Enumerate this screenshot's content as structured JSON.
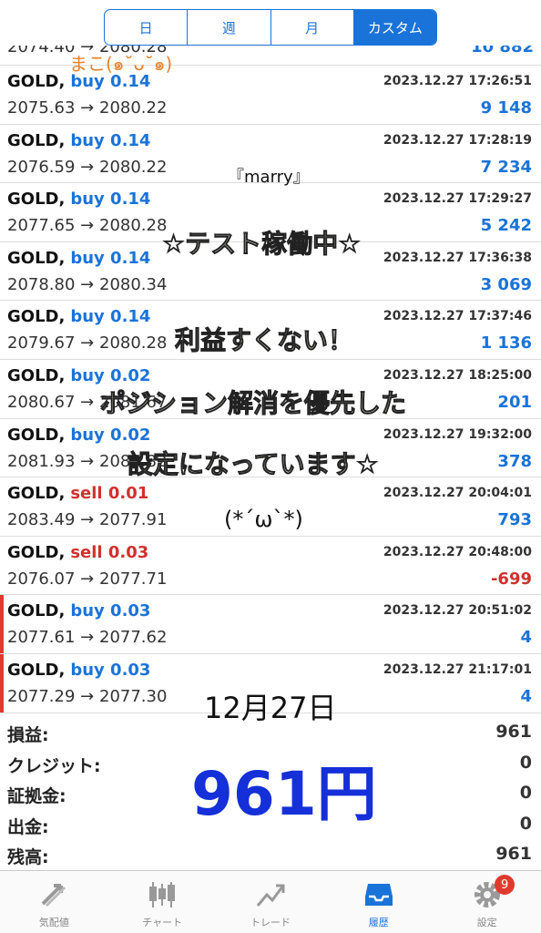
{
  "segments": [
    "日",
    "週",
    "月",
    "カスタム"
  ],
  "active_segment": "カスタム",
  "partial_row": {
    "left": "2074.40 → 2080.28",
    "right": "10 882"
  },
  "trades": [
    {
      "symbol": "GOLD,",
      "side": "buy",
      "volume": "0.14",
      "time": "2023.12.27 17:26:51",
      "open": "2075.63",
      "close": "2080.22",
      "arrow": "→",
      "profit": "9 148",
      "marked": false
    },
    {
      "symbol": "GOLD,",
      "side": "buy",
      "volume": "0.14",
      "time": "2023.12.27 17:28:19",
      "open": "2076.59",
      "close": "2080.22",
      "arrow": "→",
      "profit": "7 234",
      "marked": false
    },
    {
      "symbol": "GOLD,",
      "side": "buy",
      "volume": "0.14",
      "time": "2023.12.27 17:29:27",
      "open": "2077.65",
      "close": "2080.28",
      "arrow": "→",
      "profit": "5 242",
      "marked": false
    },
    {
      "symbol": "GOLD,",
      "side": "buy",
      "volume": "0.14",
      "time": "2023.12.27 17:36:38",
      "open": "2078.80",
      "close": "2080.34",
      "arrow": "→",
      "profit": "3 069",
      "marked": false
    },
    {
      "symbol": "GOLD,",
      "side": "buy",
      "volume": "0.14",
      "time": "2023.12.27 17:37:46",
      "open": "2079.67",
      "close": "2080.28",
      "arrow": "→",
      "profit": "1 136",
      "marked": false
    },
    {
      "symbol": "GOLD,",
      "side": "buy",
      "volume": "0.02",
      "time": "2023.12.27 18:25:00",
      "open": "2080.67",
      "close": "2081.67",
      "arrow": "→",
      "profit": "201",
      "marked": false
    },
    {
      "symbol": "GOLD,",
      "side": "buy",
      "volume": "0.02",
      "time": "2023.12.27 19:32:00",
      "open": "2081.93",
      "close": "2083.82",
      "arrow": "→",
      "profit": "378",
      "marked": false
    },
    {
      "symbol": "GOLD,",
      "side": "sell",
      "volume": "0.01",
      "time": "2023.12.27 20:04:01",
      "open": "2083.49",
      "close": "2077.91",
      "arrow": "→",
      "profit": "793",
      "marked": false
    },
    {
      "symbol": "GOLD,",
      "side": "sell",
      "volume": "0.03",
      "time": "2023.12.27 20:48:00",
      "open": "2076.07",
      "close": "2077.71",
      "arrow": "→",
      "profit": "-699",
      "marked": false
    },
    {
      "symbol": "GOLD,",
      "side": "buy",
      "volume": "0.03",
      "time": "2023.12.27 20:51:02",
      "open": "2077.61",
      "close": "2077.62",
      "arrow": "→",
      "profit": "4",
      "marked": true
    },
    {
      "symbol": "GOLD,",
      "side": "buy",
      "volume": "0.03",
      "time": "2023.12.27 21:17:01",
      "open": "2077.29",
      "close": "2077.30",
      "arrow": "→",
      "profit": "4",
      "marked": true
    }
  ],
  "summary": [
    {
      "label": "損益:",
      "value": "961"
    },
    {
      "label": "クレジット:",
      "value": "0"
    },
    {
      "label": "証拠金:",
      "value": "0"
    },
    {
      "label": "出金:",
      "value": "0"
    },
    {
      "label": "残高:",
      "value": "961"
    }
  ],
  "tabs": [
    {
      "label": "気配値",
      "icon": "quotes-arrows-icon",
      "active": false
    },
    {
      "label": "チャート",
      "icon": "candlestick-chart-icon",
      "active": false
    },
    {
      "label": "トレード",
      "icon": "trade-trend-icon",
      "active": false
    },
    {
      "label": "履歴",
      "icon": "history-inbox-icon",
      "active": true
    },
    {
      "label": "設定",
      "icon": "gear-icon",
      "active": false,
      "badge": "9"
    }
  ],
  "overlay_texts": {
    "author": "まこ(๑˘ᴗ˘๑)",
    "marry": "『marry』",
    "testing": "☆テスト稼働中☆",
    "low_profit": "利益すくない！",
    "position": "ポジション解消を優先した",
    "setting": "設定になっています☆",
    "face": "(*´ω`*)",
    "date": "12月27日",
    "yen": "961円"
  },
  "colors": {
    "accent_blue": "#1a73d9",
    "sell_red": "#d0312d",
    "marker_red": "#e03a2f",
    "handwriting_blue": "#1530d8",
    "handwriting_orange": "#e8812a"
  }
}
